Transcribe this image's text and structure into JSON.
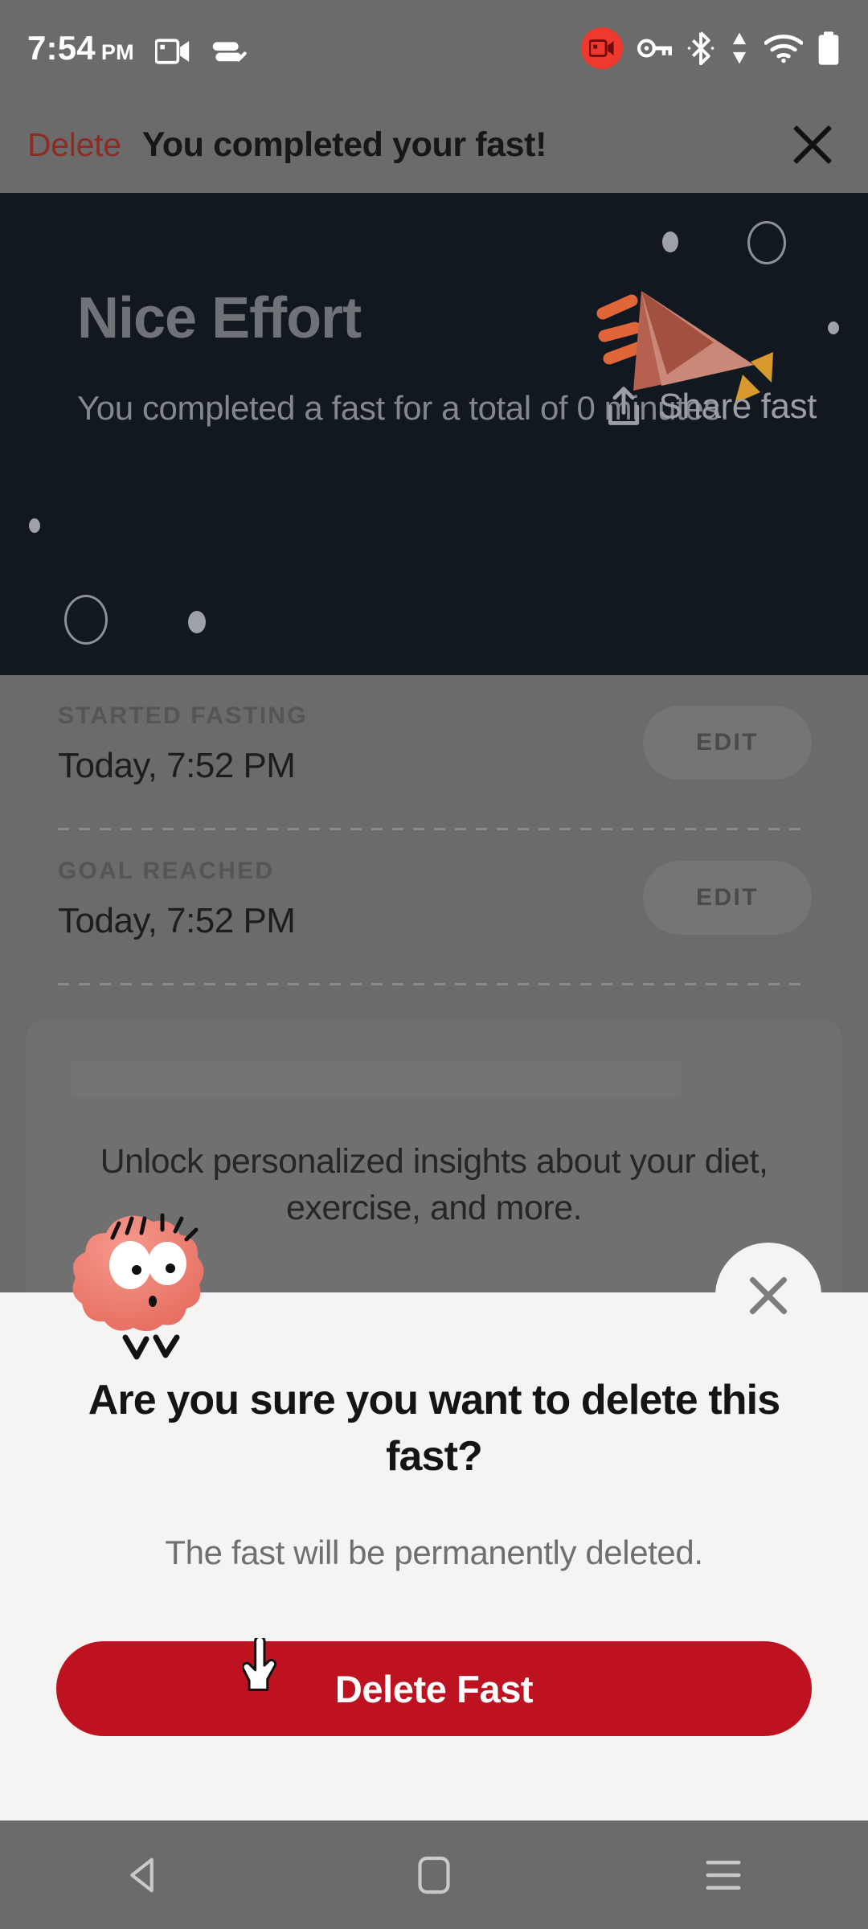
{
  "status_bar": {
    "time": "7:54",
    "ampm": "PM",
    "icons": [
      "screen-cast-icon",
      "do-not-disturb-icon",
      "screen-record-icon",
      "vpn-key-icon",
      "bluetooth-icon",
      "data-transfer-icon",
      "wifi-icon",
      "battery-icon"
    ]
  },
  "toolbar": {
    "delete_label": "Delete",
    "title": "You completed your fast!",
    "close_icon": "close-icon"
  },
  "hero": {
    "title": "Nice Effort",
    "subtitle": "You completed a fast for a total of 0 minutes.",
    "share_label": "Share fast",
    "share_icon": "share-upload-icon",
    "illustration": "party-horn-icon",
    "background": "#121820"
  },
  "details": [
    {
      "label": "STARTED FASTING",
      "value": "Today, 7:52 PM",
      "edit_label": "EDIT"
    },
    {
      "label": "GOAL REACHED",
      "value": "Today, 7:52 PM",
      "edit_label": "EDIT"
    }
  ],
  "promo": {
    "text": "Unlock personalized insights about your diet, exercise, and more."
  },
  "sheet": {
    "close_icon": "close-icon",
    "mascot": "pink-blob-mascot-icon",
    "title": "Are you sure you want to delete this fast?",
    "body": "The fast will be permanently deleted.",
    "confirm_label": "Delete Fast",
    "confirm_color": "#bf1220",
    "background": "#f5f4f3"
  },
  "nav_bar": {
    "back_icon": "back-triangle-icon",
    "home_icon": "home-square-icon",
    "recents_icon": "recents-menu-icon"
  },
  "cursor": {
    "icon": "pointer-hand-cursor"
  }
}
